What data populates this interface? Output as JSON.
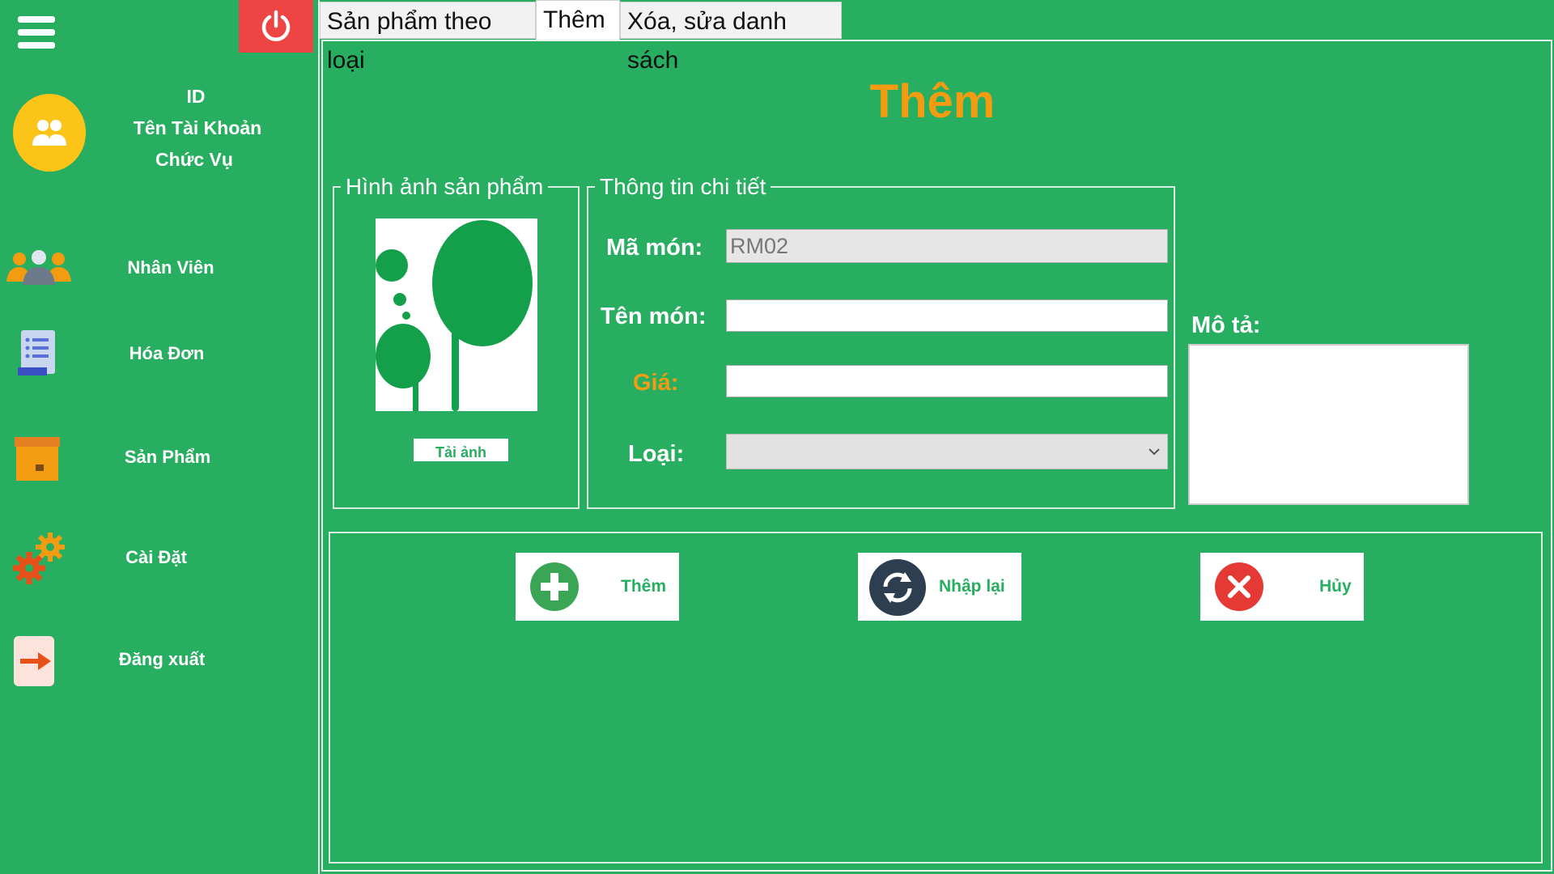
{
  "sidebar": {
    "user": {
      "id": "ID",
      "account_name": "Tên Tài Khoản",
      "position": "Chức Vụ"
    },
    "items": [
      {
        "label": "Nhân Viên",
        "icon": "people-icon"
      },
      {
        "label": "Hóa Đơn",
        "icon": "invoice-icon"
      },
      {
        "label": "Sản Phẩm",
        "icon": "box-icon"
      },
      {
        "label": "Cài Đặt",
        "icon": "gears-icon"
      },
      {
        "label": "Đăng xuất",
        "icon": "logout-icon"
      }
    ]
  },
  "tabs": [
    {
      "label": "Sản phẩm theo loại",
      "active": false
    },
    {
      "label": "Thêm",
      "active": true
    },
    {
      "label": "Xóa, sửa danh sách",
      "active": false
    }
  ],
  "page": {
    "title": "Thêm",
    "image_group": {
      "legend": "Hình ảnh sản phẩm",
      "upload_label": "Tải ảnh"
    },
    "details_group": {
      "legend": "Thông tin chi tiết",
      "code_label": "Mã món:",
      "code_value": "RM02",
      "name_label": "Tên món:",
      "name_value": "",
      "price_label": "Giá:",
      "price_value": "",
      "category_label": "Loại:",
      "category_value": ""
    },
    "description_label": "Mô tả:",
    "description_value": "",
    "buttons": {
      "add": "Thêm",
      "reset": "Nhập lại",
      "cancel": "Hủy"
    }
  },
  "colors": {
    "background": "#27ae60",
    "accent_title": "#f39c12",
    "power": "#ef4444",
    "avatar": "#fcc419"
  }
}
